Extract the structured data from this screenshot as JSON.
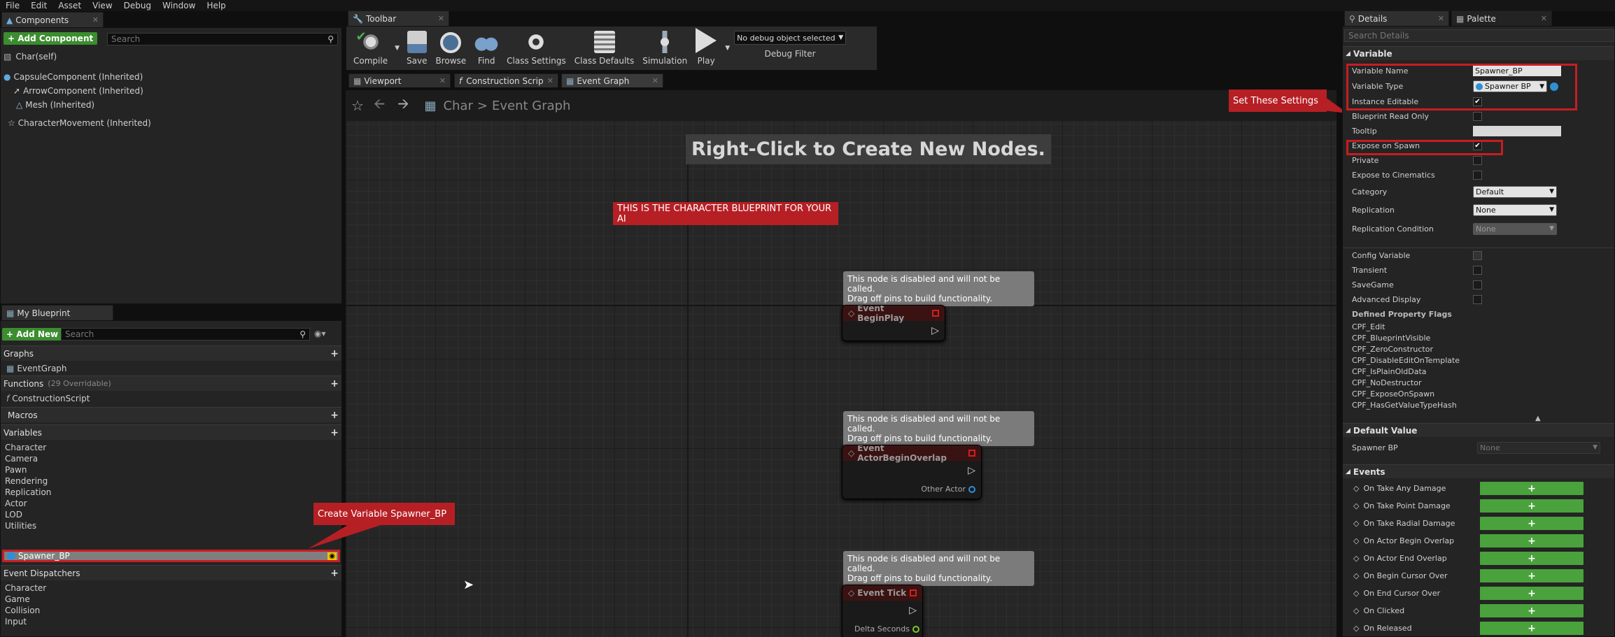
{
  "menu": [
    "File",
    "Edit",
    "Asset",
    "View",
    "Debug",
    "Window",
    "Help"
  ],
  "components_panel": {
    "tab": "Components",
    "add_button": "+ Add Component",
    "search_placeholder": "Search",
    "root": "Char(self)",
    "items": [
      "CapsuleComponent (Inherited)",
      "ArrowComponent (Inherited)",
      "Mesh (Inherited)",
      "CharacterMovement (Inherited)"
    ]
  },
  "toolbar": {
    "tab": "Toolbar",
    "buttons": [
      "Compile",
      "Save",
      "Browse",
      "Find",
      "Class Settings",
      "Class Defaults",
      "Simulation",
      "Play"
    ],
    "debug_select": "No debug object selected",
    "debug_filter": "Debug Filter"
  },
  "editor_tabs": [
    "Viewport",
    "Construction Scrip",
    "Event Graph"
  ],
  "breadcrumb": {
    "root": "Char",
    "sep": ">",
    "current": "Event Graph"
  },
  "graph": {
    "hint": "Right-Click to Create New Nodes.",
    "note_character": "THIS IS THE CHARACTER BLUEPRINT FOR YOUR AI",
    "comment_line1": "This node is disabled and will not be called.",
    "comment_line2": "Drag off pins to build functionality.",
    "nodes": [
      {
        "title": "Event BeginPlay",
        "pin": ""
      },
      {
        "title": "Event ActorBeginOverlap",
        "pin": "Other Actor"
      },
      {
        "title": "Event Tick",
        "pin": "Delta Seconds"
      }
    ]
  },
  "my_blueprint": {
    "tab": "My Blueprint",
    "add_new": "+ Add New",
    "search_placeholder": "Search",
    "graphs_header": "Graphs",
    "graph_item": "EventGraph",
    "functions_header": "Functions",
    "functions_count": "(29 Overridable)",
    "function_item": "ConstructionScript",
    "macros_header": "Macros",
    "variables_header": "Variables",
    "variable_categories": [
      "Character",
      "Camera",
      "Pawn",
      "Rendering",
      "Replication",
      "Actor",
      "LOD",
      "Utilities"
    ],
    "selected_variable": "Spawner_BP",
    "dispatchers_header": "Event Dispatchers",
    "dispatcher_categories": [
      "Character",
      "Game",
      "Collision",
      "Input"
    ]
  },
  "annotation_create": "Create Variable Spawner_BP",
  "annotation_settings": "Set These Settings",
  "details": {
    "tab": "Details",
    "palette_tab": "Palette",
    "search_placeholder": "Search Details",
    "variable_section": "Variable",
    "variable_name_label": "Variable Name",
    "variable_name_value": "Spawner_BP",
    "variable_type_label": "Variable Type",
    "variable_type_value": "Spawner BP",
    "instance_editable": "Instance Editable",
    "blueprint_read_only": "Blueprint Read Only",
    "tooltip": "Tooltip",
    "expose_on_spawn": "Expose on Spawn",
    "private": "Private",
    "expose_to_cinematics": "Expose to Cinematics",
    "category_label": "Category",
    "category_value": "Default",
    "replication_label": "Replication",
    "replication_value": "None",
    "replication_condition_label": "Replication Condition",
    "replication_condition_value": "None",
    "config_variable": "Config Variable",
    "transient": "Transient",
    "savegame": "SaveGame",
    "advanced_display": "Advanced Display",
    "defined_flags_header": "Defined Property Flags",
    "flags": [
      "CPF_Edit",
      "CPF_BlueprintVisible",
      "CPF_ZeroConstructor",
      "CPF_DisableEditOnTemplate",
      "CPF_IsPlainOldData",
      "CPF_NoDestructor",
      "CPF_ExposeOnSpawn",
      "CPF_HasGetValueTypeHash"
    ],
    "default_value_section": "Default Value",
    "default_label": "Spawner BP",
    "default_value": "None",
    "events_section": "Events",
    "events": [
      "On Take Any Damage",
      "On Take Point Damage",
      "On Take Radial Damage",
      "On Actor Begin Overlap",
      "On Actor End Overlap",
      "On Begin Cursor Over",
      "On End Cursor Over",
      "On Clicked",
      "On Released"
    ]
  },
  "colors": {
    "accent_red": "#b61f24",
    "add_green": "#3b8d2f",
    "event_green": "#4aa23c"
  }
}
